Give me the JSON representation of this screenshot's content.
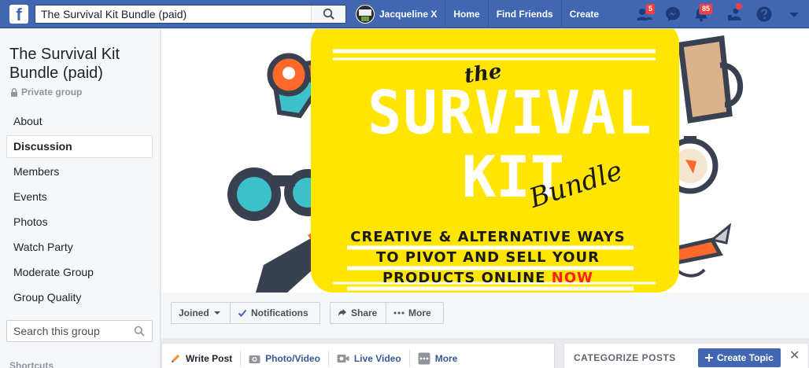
{
  "topbar": {
    "logo": "f",
    "search_value": "The Survival Kit Bundle (paid)",
    "profile_name": "Jacqueline X",
    "links": [
      "Home",
      "Find Friends",
      "Create"
    ],
    "friend_requests_count": "5",
    "notifications_count": "85",
    "icons": [
      "friends-icon",
      "messenger-icon",
      "notifications-icon",
      "quick-help-icon",
      "help-icon",
      "account-menu-icon"
    ]
  },
  "sidebar": {
    "group_name": "The Survival Kit Bundle (paid)",
    "privacy": "Private group",
    "items": [
      {
        "label": "About"
      },
      {
        "label": "Discussion"
      },
      {
        "label": "Members"
      },
      {
        "label": "Events"
      },
      {
        "label": "Photos"
      },
      {
        "label": "Watch Party"
      },
      {
        "label": "Moderate Group"
      },
      {
        "label": "Group Quality"
      }
    ],
    "active_item": "Discussion",
    "search_placeholder": "Search this group",
    "shortcuts_label": "Shortcuts"
  },
  "cover": {
    "the": "the",
    "survival": "SURVIVAL",
    "kit": "KIT",
    "bundle": "Bundle",
    "tagline_1": "CREATIVE & ALTERNATIVE WAYS",
    "tagline_2": "TO PIVOT AND SELL YOUR",
    "tagline_3": "PRODUCTS ONLINE",
    "tagline_now": "NOW",
    "colors": {
      "panel": "#ffe500",
      "accent": "#ff1f1f",
      "teal": "#3cc0c9",
      "orange": "#ff6a2b",
      "dark": "#39404f"
    }
  },
  "actions": {
    "joined": "Joined",
    "notifications": "Notifications",
    "share": "Share",
    "more": "More"
  },
  "composer": {
    "write_post": "Write Post",
    "photo_video": "Photo/Video",
    "live_video": "Live Video",
    "more": "More"
  },
  "categorize": {
    "title": "CATEGORIZE POSTS",
    "create_topic": "Create Topic",
    "close": "✕"
  },
  "colors": {
    "brand": "#4267b2",
    "link": "#365899",
    "badge": "#fa3e3e"
  }
}
